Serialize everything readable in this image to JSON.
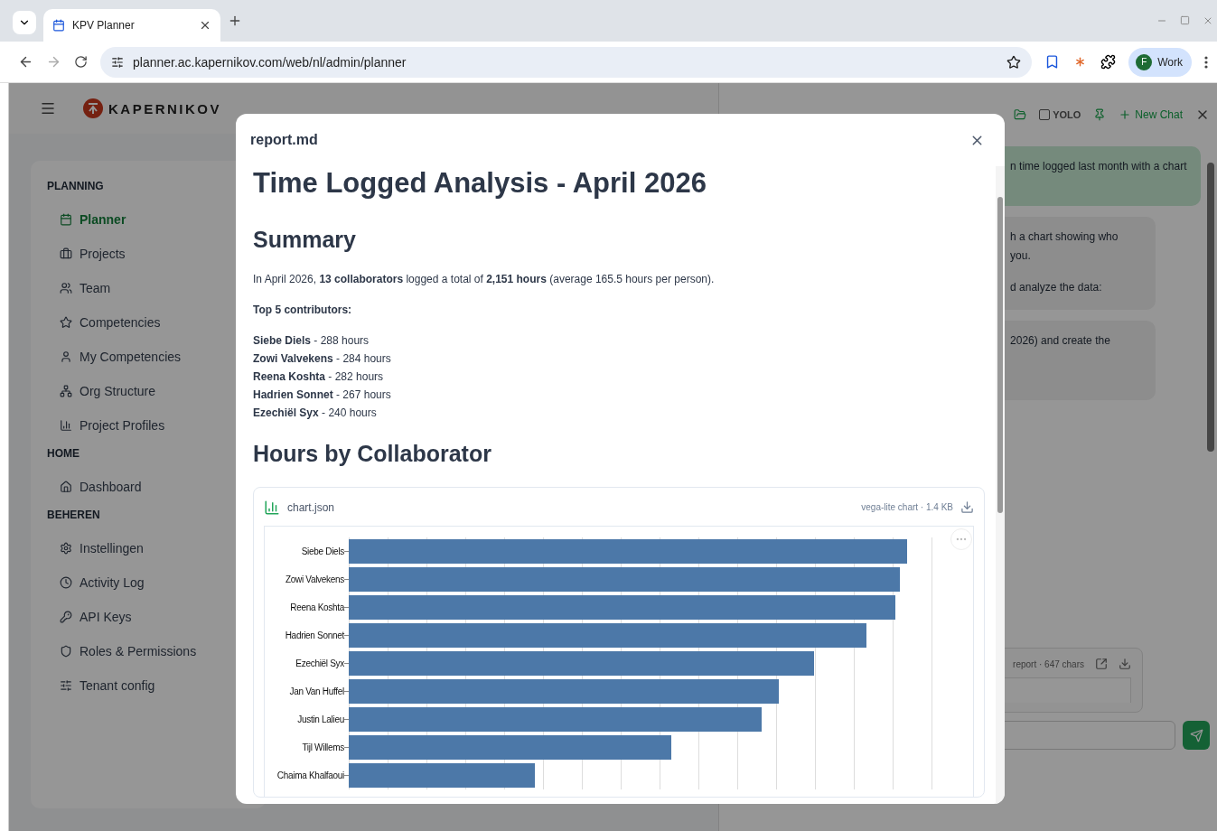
{
  "browser": {
    "tab": {
      "title": "KPV Planner"
    },
    "url": "planner.ac.kapernikov.com/web/nl/admin/planner",
    "profile": {
      "initial": "F",
      "name": "Work"
    }
  },
  "app": {
    "logo": "KAPERNIKOV"
  },
  "sidebar": {
    "sections": [
      {
        "title": "PLANNING",
        "items": [
          {
            "label": "Planner",
            "selected": true
          },
          {
            "label": "Projects",
            "selected": false
          },
          {
            "label": "Team",
            "selected": false
          },
          {
            "label": "Competencies",
            "selected": false
          },
          {
            "label": "My Competencies",
            "selected": false
          },
          {
            "label": "Org Structure",
            "selected": false
          },
          {
            "label": "Project Profiles",
            "selected": false
          }
        ]
      },
      {
        "title": "HOME",
        "items": [
          {
            "label": "Dashboard",
            "selected": false
          }
        ]
      },
      {
        "title": "BEHEREN",
        "items": [
          {
            "label": "Instellingen",
            "selected": false
          },
          {
            "label": "Activity Log",
            "selected": false
          },
          {
            "label": "API Keys",
            "selected": false
          },
          {
            "label": "Roles & Permissions",
            "selected": false
          },
          {
            "label": "Tenant config",
            "selected": false
          }
        ]
      }
    ]
  },
  "chat": {
    "yolo": {
      "label": "YOLO",
      "checked": false
    },
    "new_chat": "New Chat",
    "messages": [
      {
        "kind": "user",
        "paragraphs": [
          [
            "n time logged last month with a chart"
          ]
        ]
      },
      {
        "kind": "assistant",
        "paragraphs": [
          [
            "h a chart showing who",
            "you."
          ],
          [
            "d analyze the data:"
          ]
        ]
      },
      {
        "kind": "assistant",
        "paragraphs": [
          [
            "2026) and create the"
          ]
        ]
      }
    ],
    "attachment": {
      "label": "report · 647 chars"
    }
  },
  "modal": {
    "title": "report.md",
    "blocks": [
      {
        "kind": "h1",
        "text": "Time Logged Analysis - April 2026"
      },
      {
        "kind": "h2",
        "text": "Summary"
      },
      {
        "kind": "p",
        "text": "In April 2026, **13 collaborators** logged a total of **2,151 hours** (average 165.5 hours per person)."
      },
      {
        "kind": "strong",
        "text": "Top 5 contributors:"
      },
      {
        "kind": "list",
        "items": [
          "**Siebe Diels** - 288 hours",
          "**Zowi Valvekens** - 284 hours",
          "**Reena Koshta** - 282 hours",
          "**Hadrien Sonnet** - 267 hours",
          "**Ezechiël Syx** - 240 hours"
        ]
      },
      {
        "kind": "h2",
        "text": "Hours by Collaborator"
      },
      {
        "kind": "chart",
        "file": "chart.json",
        "meta": "vega-lite chart · 1.4 KB",
        "labels": [
          "Siebe Diels",
          "Zowi Valvekens",
          "Reena Koshta",
          "Hadrien Sonnet",
          "Ezechiël Syx",
          "Jan Van Huffel",
          "Justin Lalieu",
          "Tijl Willems",
          "Chaima Khalfaoui"
        ]
      }
    ]
  }
}
